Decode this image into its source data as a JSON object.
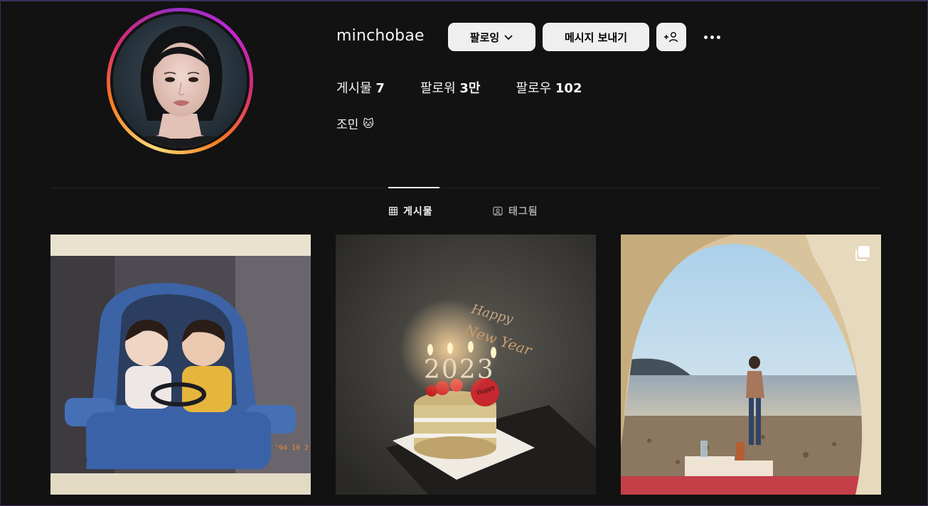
{
  "profile": {
    "username": "minchobae",
    "bio": "조민",
    "bio_emoji": "🐱",
    "stats": [
      {
        "label": "게시물",
        "value": "7"
      },
      {
        "label": "팔로워",
        "value": "3만"
      },
      {
        "label": "팔로우",
        "value": "102"
      }
    ]
  },
  "actions": {
    "following_label": "팔로잉",
    "message_label": "메시지 보내기",
    "add_user_label": "+"
  },
  "tabs": [
    {
      "label": "게시물",
      "icon": "grid-icon",
      "active": true
    },
    {
      "label": "태그됨",
      "icon": "tagged-icon",
      "active": false
    }
  ],
  "posts": [
    {
      "name": "childhood-photo",
      "multi": false
    },
    {
      "name": "new-year-cake",
      "multi": false,
      "cake_text": "2023",
      "topper_text": "Happy New Year"
    },
    {
      "name": "beach-tent",
      "multi": true
    }
  ],
  "colors": {
    "background": "#121212",
    "button_bg": "#efefef",
    "divider": "#262626",
    "muted_text": "#a8a8a8"
  }
}
